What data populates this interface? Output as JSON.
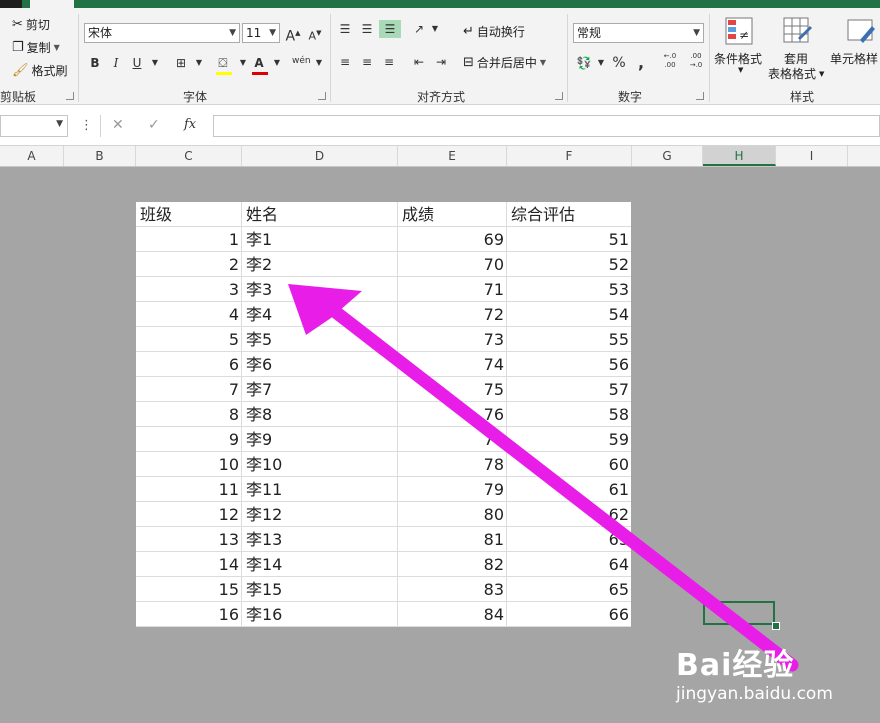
{
  "ribbon": {
    "clipboard": {
      "cut": "剪切",
      "copy": "复制",
      "format_painter": "格式刷",
      "label": "剪贴板"
    },
    "font": {
      "name": "宋体",
      "size": "11",
      "grow": "A",
      "shrink": "A",
      "bold": "B",
      "italic": "I",
      "underline": "U",
      "font_color": "A",
      "phonetic": "wén",
      "label": "字体"
    },
    "alignment": {
      "wrap_text": "自动换行",
      "merge_center": "合并后居中",
      "label": "对齐方式"
    },
    "number": {
      "format": "常规",
      "percent": "%",
      "comma": ",",
      "inc_decimal": "←.0 .00",
      "dec_decimal": ".00 →.0",
      "label": "数字"
    },
    "styles": {
      "conditional": "条件格式",
      "table_format_1": "套用",
      "table_format_2": "表格格式",
      "cell_styles": "单元格样",
      "label": "样式"
    }
  },
  "formula_bar": {
    "fx": "fx",
    "cancel": "✕",
    "enter": "✓",
    "colon": "⋮"
  },
  "columns": [
    "A",
    "B",
    "C",
    "D",
    "E",
    "F",
    "G",
    "H",
    "I"
  ],
  "table": {
    "headers": [
      "班级",
      "姓名",
      "成绩",
      "综合评估"
    ],
    "rows": [
      [
        "1",
        "李1",
        "69",
        "51"
      ],
      [
        "2",
        "李2",
        "70",
        "52"
      ],
      [
        "3",
        "李3",
        "71",
        "53"
      ],
      [
        "4",
        "李4",
        "72",
        "54"
      ],
      [
        "5",
        "李5",
        "73",
        "55"
      ],
      [
        "6",
        "李6",
        "74",
        "56"
      ],
      [
        "7",
        "李7",
        "75",
        "57"
      ],
      [
        "8",
        "李8",
        "76",
        "58"
      ],
      [
        "9",
        "李9",
        "77",
        "59"
      ],
      [
        "10",
        "李10",
        "78",
        "60"
      ],
      [
        "11",
        "李11",
        "79",
        "61"
      ],
      [
        "12",
        "李12",
        "80",
        "62"
      ],
      [
        "13",
        "李13",
        "81",
        "63"
      ],
      [
        "14",
        "李14",
        "82",
        "64"
      ],
      [
        "15",
        "李15",
        "83",
        "65"
      ],
      [
        "16",
        "李16",
        "84",
        "66"
      ]
    ]
  },
  "watermark": {
    "brand": "Bai经验",
    "url": "jingyan.baidu.com"
  },
  "colors": {
    "excel_green": "#217346",
    "arrow": "#e81ee8",
    "sheet_bg": "#a5a5a5"
  }
}
